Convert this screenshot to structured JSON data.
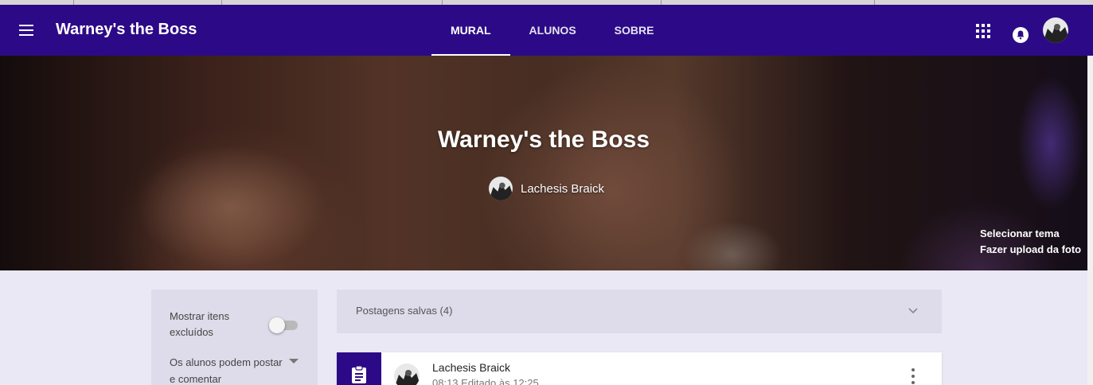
{
  "app": {
    "class_name": "Warney's the Boss",
    "accent_color": "#2c0a87"
  },
  "tabs": [
    {
      "label": "MURAL",
      "active": true
    },
    {
      "label": "ALUNOS",
      "active": false
    },
    {
      "label": "SOBRE",
      "active": false
    }
  ],
  "header_icons": [
    "menu-icon",
    "apps-icon",
    "notifications-bell-icon",
    "user-avatar"
  ],
  "banner": {
    "title": "Warney's the Boss",
    "teacher_name": "Lachesis Braick",
    "select_theme": "Selecionar tema",
    "upload_photo": "Fazer upload da foto"
  },
  "settings": {
    "show_deleted_label": "Mostrar itens excluídos",
    "show_deleted_enabled": false,
    "permission_label": "Os alunos podem postar e comentar"
  },
  "saved_posts": {
    "label": "Postagens salvas (4)"
  },
  "post": {
    "author": "Lachesis Braick",
    "time": "08:13 Editado às 12:25",
    "type_icon": "assignment-icon"
  }
}
